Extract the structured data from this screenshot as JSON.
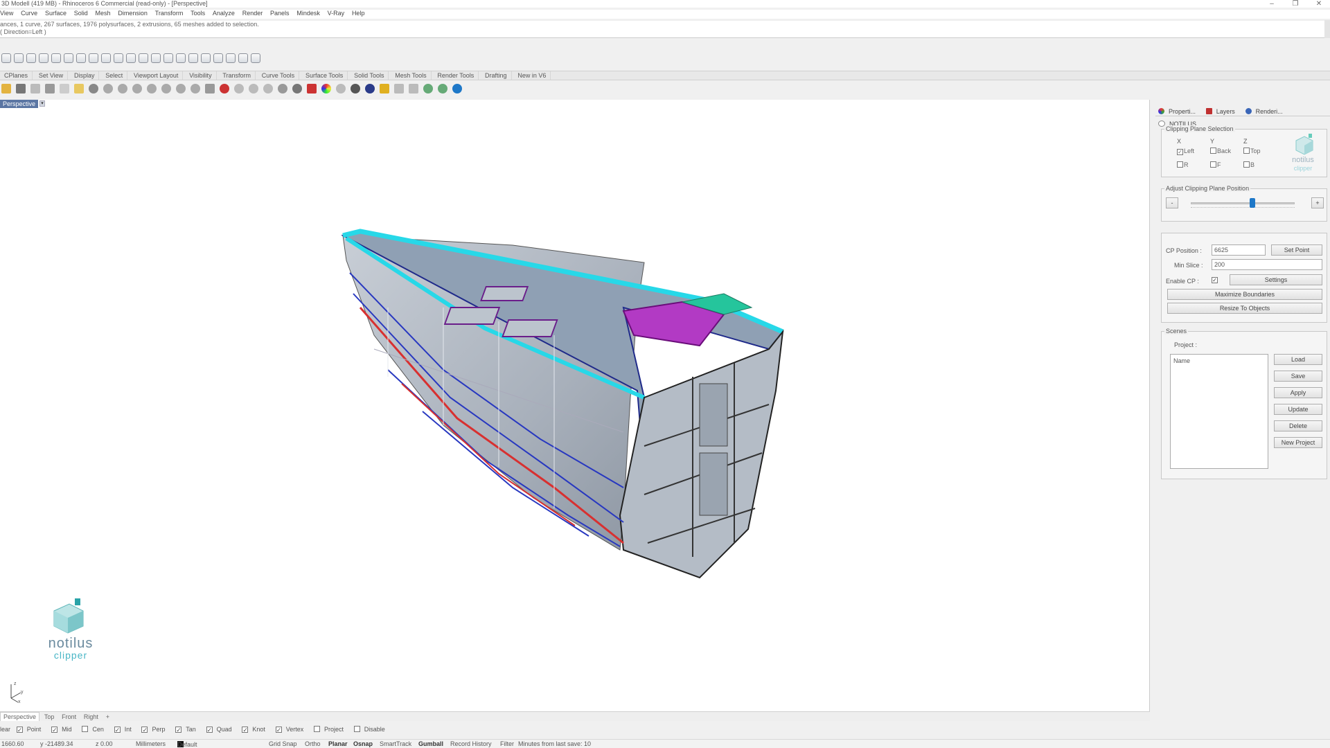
{
  "window": {
    "title": "3D Modell (419 MB) - Rhinoceros 6 Commercial (read-only) - [Perspective]",
    "controls": [
      "–",
      "❐",
      "✕"
    ]
  },
  "menu": [
    "View",
    "Curve",
    "Surface",
    "Solid",
    "Mesh",
    "Dimension",
    "Transform",
    "Tools",
    "Analyze",
    "Render",
    "Panels",
    "Mindesk",
    "V-Ray",
    "Help"
  ],
  "command_history": [
    "ances, 1 curve, 267 surfaces, 1976 polysurfaces, 2 extrusions, 65 meshes added to selection.",
    "( Direction=Left )"
  ],
  "toolbar_tabs": [
    "CPlanes",
    "Set View",
    "Display",
    "Select",
    "Viewport Layout",
    "Visibility",
    "Transform",
    "Curve Tools",
    "Surface Tools",
    "Solid Tools",
    "Mesh Tools",
    "Render Tools",
    "Drafting",
    "New in V6"
  ],
  "viewport": {
    "label": "Perspective",
    "dropdown": "▾",
    "logo": {
      "line1": "notilus",
      "line2": "clipper"
    },
    "axis": {
      "x": "x",
      "y": "y",
      "z": "z"
    }
  },
  "viewport_tabs": [
    "Perspective",
    "Top",
    "Front",
    "Right",
    "+"
  ],
  "osnaps": [
    {
      "label": "lear",
      "checked": null
    },
    {
      "label": "Point",
      "checked": true
    },
    {
      "label": "Mid",
      "checked": true
    },
    {
      "label": "Cen",
      "checked": false
    },
    {
      "label": "Int",
      "checked": true
    },
    {
      "label": "Perp",
      "checked": true
    },
    {
      "label": "Tan",
      "checked": true
    },
    {
      "label": "Quad",
      "checked": true
    },
    {
      "label": "Knot",
      "checked": true
    },
    {
      "label": "Vertex",
      "checked": true
    },
    {
      "label": "Project",
      "checked": false
    },
    {
      "label": "Disable",
      "checked": false
    }
  ],
  "status": {
    "x": "1660.60",
    "y": "y -21489.34",
    "z": "z 0.00",
    "units": "Millimeters",
    "layer": "Default",
    "grid_snap": "Grid Snap",
    "ortho": "Ortho",
    "planar": "Planar",
    "osnap": "Osnap",
    "smarttrack": "SmartTrack",
    "gumball": "Gumball",
    "record_history": "Record History",
    "filter": "Filter",
    "last_save": "Minutes from last save: 10"
  },
  "panel_tabs": [
    {
      "label": "Properti...",
      "color": "#d04848"
    },
    {
      "label": "Layers",
      "color": "#c03030"
    },
    {
      "label": "Renderi...",
      "color": "#3a66b8"
    },
    {
      "label": "NOTILUS...",
      "color": "#888888"
    }
  ],
  "clipping": {
    "group_title": "Clipping Plane Selection",
    "axes": [
      "X",
      "Y",
      "Z"
    ],
    "checks": [
      {
        "label": "Left",
        "checked": true
      },
      {
        "label": "Back",
        "checked": false
      },
      {
        "label": "Top",
        "checked": false
      },
      {
        "label": "R",
        "checked": false
      },
      {
        "label": "F",
        "checked": false
      },
      {
        "label": "B",
        "checked": false
      }
    ],
    "logo": {
      "line1": "notilus",
      "line2": "clipper"
    }
  },
  "position": {
    "group_title": "Adjust Clipping Plane Position",
    "minus": "-",
    "plus": "+",
    "value_pct": 59
  },
  "cp": {
    "position_label": "CP Position :",
    "position_value": "6625",
    "set_point": "Set Point",
    "min_slice_label": "Min Slice :",
    "min_slice_value": "200",
    "enable_label": "Enable CP :",
    "enable_checked": true,
    "settings": "Settings",
    "maximize": "Maximize Boundaries",
    "resize": "Resize To Objects"
  },
  "scenes": {
    "group_title": "Scenes",
    "project_label": "Project :",
    "list_header": "Name",
    "buttons": [
      "Load",
      "Save",
      "Apply",
      "Update",
      "Delete",
      "New Project"
    ]
  }
}
